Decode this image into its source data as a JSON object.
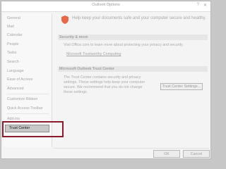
{
  "window": {
    "title": "Outlook Options",
    "help_glyph": "?",
    "close_glyph": "✕"
  },
  "sidebar": {
    "items": [
      {
        "label": "General"
      },
      {
        "label": "Mail"
      },
      {
        "label": "Calendar"
      },
      {
        "label": "People"
      },
      {
        "label": "Tasks"
      },
      {
        "label": "Search"
      },
      {
        "label": "Language"
      },
      {
        "label": "Ease of Access"
      },
      {
        "label": "Advanced"
      },
      {
        "label": "Customize Ribbon"
      },
      {
        "label": "Quick Access Toolbar"
      },
      {
        "label": "Add-ins"
      },
      {
        "label": "Trust Center"
      }
    ],
    "selected": "Trust Center"
  },
  "content": {
    "heading": "Help keep your documents safe and your computer secure and healthy.",
    "security_section": {
      "title": "Security & more",
      "text": "Visit Office.com to learn more about protecting your privacy and security.",
      "link": "Microsoft Trustworthy Computing"
    },
    "trust_center_section": {
      "title": "Microsoft Outlook Trust Center",
      "text_lines": [
        "The Trust Center contains security and privacy",
        "settings. These settings help keep your computer",
        "secure. We recommend that you do not change",
        "these settings."
      ],
      "button_label": "Trust Center Settings..."
    }
  },
  "footer": {
    "ok_label": "OK",
    "cancel_label": "Cancel"
  },
  "colors": {
    "highlight_border": "#8b1a2c",
    "shield": "#e8694a"
  }
}
